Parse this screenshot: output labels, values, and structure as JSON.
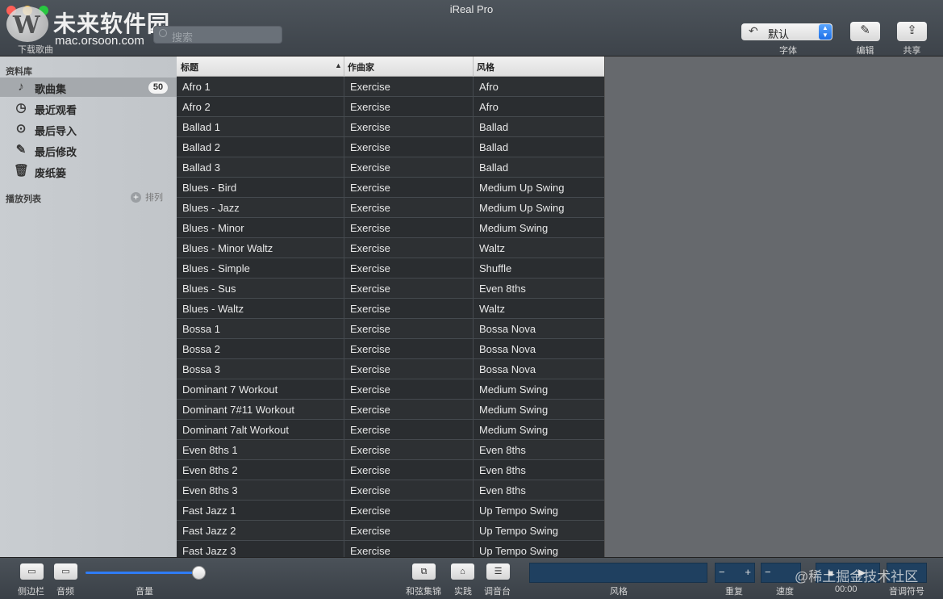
{
  "window": {
    "title": "iReal Pro"
  },
  "brand": {
    "cn": "未来软件园",
    "en": "mac.orsoon.com"
  },
  "toolbar": {
    "download_label": "下载歌曲",
    "search_placeholder": "搜索",
    "font_value": "默认",
    "font_label": "字体",
    "edit_label": "编辑",
    "share_label": "共享"
  },
  "sidebar": {
    "library_header": "资料库",
    "items": [
      {
        "label": "歌曲集",
        "icon": "music-note-icon",
        "badge": "50",
        "selected": true
      },
      {
        "label": "最近观看",
        "icon": "clock-icon"
      },
      {
        "label": "最后导入",
        "icon": "download-circle-icon"
      },
      {
        "label": "最后修改",
        "icon": "pencil-icon"
      },
      {
        "label": "废纸篓",
        "icon": "trash-icon"
      }
    ],
    "playlists_header": "播放列表",
    "sort_label": "排列"
  },
  "table": {
    "headers": {
      "title": "标题",
      "composer": "作曲家",
      "style": "风格"
    },
    "rows": [
      [
        "Afro 1",
        "Exercise",
        "Afro"
      ],
      [
        "Afro 2",
        "Exercise",
        "Afro"
      ],
      [
        "Ballad 1",
        "Exercise",
        "Ballad"
      ],
      [
        "Ballad 2",
        "Exercise",
        "Ballad"
      ],
      [
        "Ballad 3",
        "Exercise",
        "Ballad"
      ],
      [
        "Blues - Bird",
        "Exercise",
        "Medium Up Swing"
      ],
      [
        "Blues - Jazz",
        "Exercise",
        "Medium Up Swing"
      ],
      [
        "Blues - Minor",
        "Exercise",
        "Medium Swing"
      ],
      [
        "Blues - Minor Waltz",
        "Exercise",
        "Waltz"
      ],
      [
        "Blues - Simple",
        "Exercise",
        "Shuffle"
      ],
      [
        "Blues - Sus",
        "Exercise",
        "Even 8ths"
      ],
      [
        "Blues - Waltz",
        "Exercise",
        "Waltz"
      ],
      [
        "Bossa 1",
        "Exercise",
        "Bossa Nova"
      ],
      [
        "Bossa 2",
        "Exercise",
        "Bossa Nova"
      ],
      [
        "Bossa 3",
        "Exercise",
        "Bossa Nova"
      ],
      [
        "Dominant 7 Workout",
        "Exercise",
        "Medium Swing"
      ],
      [
        "Dominant 7#11 Workout",
        "Exercise",
        "Medium Swing"
      ],
      [
        "Dominant 7alt Workout",
        "Exercise",
        "Medium Swing"
      ],
      [
        "Even 8ths 1",
        "Exercise",
        "Even 8ths"
      ],
      [
        "Even 8ths 2",
        "Exercise",
        "Even 8ths"
      ],
      [
        "Even 8ths 3",
        "Exercise",
        "Even 8ths"
      ],
      [
        "Fast Jazz 1",
        "Exercise",
        "Up Tempo Swing"
      ],
      [
        "Fast Jazz 2",
        "Exercise",
        "Up Tempo Swing"
      ],
      [
        "Fast Jazz 3",
        "Exercise",
        "Up Tempo Swing"
      ]
    ]
  },
  "bottombar": {
    "sidebar_label": "侧边栏",
    "audio_label": "音频",
    "volume_label": "音量",
    "volume_level": 1.0,
    "chords_label": "和弦集锦",
    "practice_label": "实践",
    "mixer_label": "调音台",
    "style_label": "风格",
    "repeat_label": "重复",
    "tempo_label": "速度",
    "time": "00:00",
    "key_label": "音调符号",
    "minus": "−",
    "plus": "+"
  },
  "watermark": "@稀土掘金技术社区",
  "colors": {
    "accent": "#2f7cf6",
    "display_bg": "#1f4060"
  }
}
